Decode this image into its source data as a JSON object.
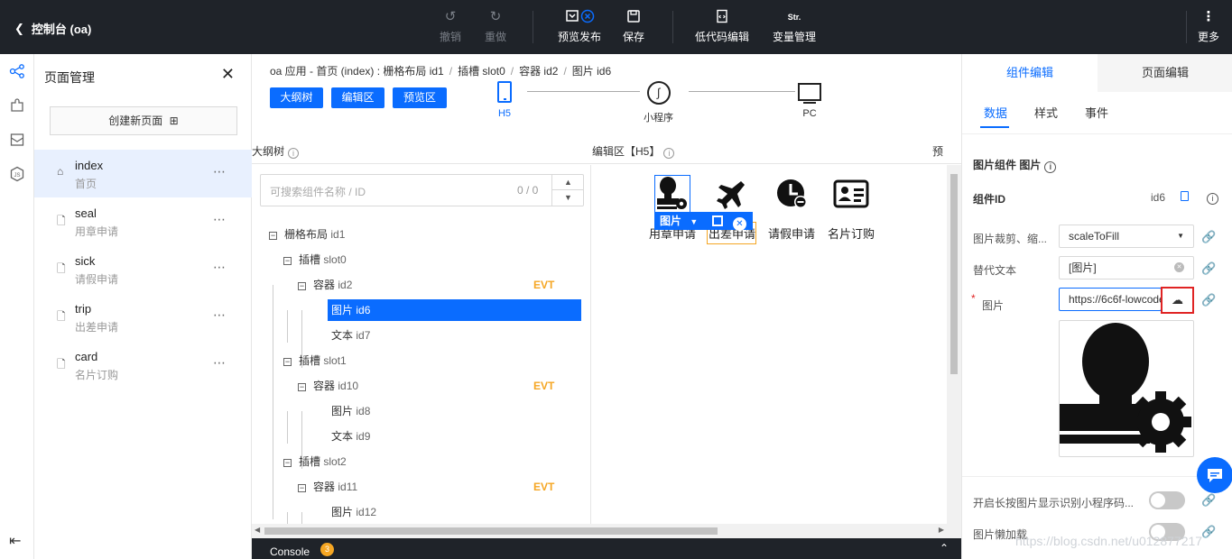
{
  "topbar": {
    "back_label": "控制台 (oa)",
    "buttons": [
      {
        "label": "撤销",
        "icon": "undo-icon",
        "disabled": true
      },
      {
        "label": "重做",
        "icon": "redo-icon",
        "disabled": true
      },
      {
        "label": "预览发布",
        "icon": "preview-icon",
        "disabled": false
      },
      {
        "label": "保存",
        "icon": "save-icon",
        "disabled": false
      },
      {
        "label": "低代码编辑",
        "icon": "code-edit-icon",
        "disabled": false
      },
      {
        "label": "变量管理",
        "icon": "variable-icon",
        "disabled": false
      },
      {
        "label": "更多",
        "icon": "more-vertical-icon",
        "disabled": false
      }
    ],
    "variable_icon_text": "Str."
  },
  "rail": [
    "outline-icon",
    "component-icon",
    "template-icon",
    "js-icon"
  ],
  "page_mgmt": {
    "title": "页面管理",
    "create_label": "创建新页面",
    "pages": [
      {
        "name": "index",
        "desc": "首页",
        "active": true
      },
      {
        "name": "seal",
        "desc": "用章申请",
        "active": false
      },
      {
        "name": "sick",
        "desc": "请假申请",
        "active": false
      },
      {
        "name": "trip",
        "desc": "出差申请",
        "active": false
      },
      {
        "name": "card",
        "desc": "名片订购",
        "active": false
      }
    ]
  },
  "breadcrumb": [
    "oa 应用 - 首页 (index) : 栅格布局 id1",
    "插槽 slot0",
    "容器 id2",
    "图片 id6"
  ],
  "view_tabs": [
    "大纲树",
    "编辑区",
    "预览区"
  ],
  "devices": [
    "H5",
    "小程序",
    "PC"
  ],
  "panes": {
    "outline": "大纲树",
    "editor": "编辑区【H5】",
    "preview": "预"
  },
  "search": {
    "placeholder": "可搜索组件名称 / ID",
    "count": "0 / 0"
  },
  "tree": [
    {
      "label": "栅格布局",
      "id": "id1",
      "level": 0,
      "toggle": "−",
      "evt": ""
    },
    {
      "label": "插槽",
      "id": "slot0",
      "level": 1,
      "toggle": "−",
      "evt": ""
    },
    {
      "label": "容器",
      "id": "id2",
      "level": 2,
      "toggle": "−",
      "evt": "EVT"
    },
    {
      "label": "图片",
      "id": "id6",
      "level": 3,
      "toggle": "",
      "evt": "",
      "selected": true
    },
    {
      "label": "文本",
      "id": "id7",
      "level": 3,
      "toggle": "",
      "evt": ""
    },
    {
      "label": "插槽",
      "id": "slot1",
      "level": 1,
      "toggle": "−",
      "evt": ""
    },
    {
      "label": "容器",
      "id": "id10",
      "level": 2,
      "toggle": "−",
      "evt": "EVT"
    },
    {
      "label": "图片",
      "id": "id8",
      "level": 3,
      "toggle": "",
      "evt": ""
    },
    {
      "label": "文本",
      "id": "id9",
      "level": 3,
      "toggle": "",
      "evt": ""
    },
    {
      "label": "插槽",
      "id": "slot2",
      "level": 1,
      "toggle": "−",
      "evt": ""
    },
    {
      "label": "容器",
      "id": "id11",
      "level": 2,
      "toggle": "−",
      "evt": "EVT"
    },
    {
      "label": "图片",
      "id": "id12",
      "level": 3,
      "toggle": "",
      "evt": ""
    }
  ],
  "canvas": {
    "cells": [
      {
        "caption": "用章申请",
        "icon": "seal-stamp-icon"
      },
      {
        "caption": "出差申请",
        "icon": "airplane-icon"
      },
      {
        "caption": "请假申请",
        "icon": "clock-minus-icon"
      },
      {
        "caption": "名片订购",
        "icon": "id-card-icon"
      }
    ],
    "selection_label": "图片"
  },
  "console": {
    "label": "Console",
    "badge": "3"
  },
  "right": {
    "tabs": [
      "组件编辑",
      "页面编辑"
    ],
    "subtabs": [
      "数据",
      "样式",
      "事件"
    ],
    "component_title": "图片组件 图片",
    "component_id_label": "组件ID",
    "component_id_value": "id6",
    "fields": [
      {
        "label": "图片裁剪、缩...",
        "value": "scaleToFill"
      },
      {
        "label": "替代文本",
        "value": "[图片]"
      },
      {
        "label": "图片",
        "value": "https://6c6f-lowcode",
        "required": true
      }
    ],
    "toggles": [
      "开启长按图片显示识别小程序码...",
      "图片懒加载"
    ]
  },
  "watermark": "https://blog.csdn.net/u012877217"
}
